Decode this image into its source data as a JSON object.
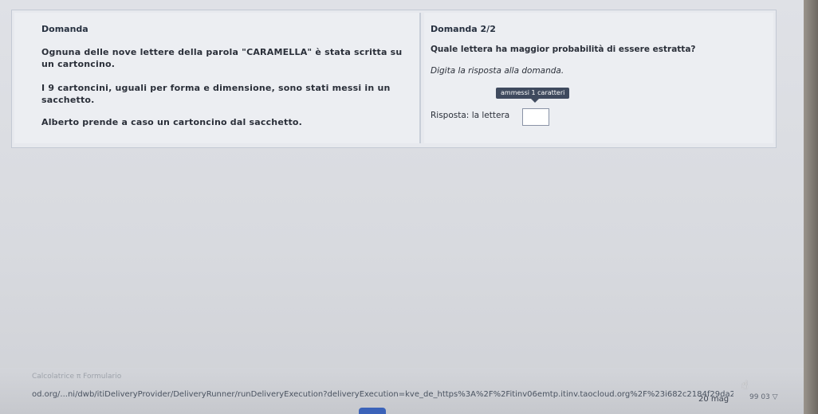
{
  "left": {
    "title": "Domanda",
    "p1a": "Ognuna delle nove lettere della parola \"CARAMELLA\" è stata scritta su",
    "p1b": "un cartoncino.",
    "p2a": "I 9 cartoncini, uguali per forma e dimensione, sono stati messi in un",
    "p2b": "sacchetto.",
    "p3": "Alberto prende a caso un cartoncino dal sacchetto."
  },
  "right": {
    "title": "Domanda 2/2",
    "question": "Quale lettera ha maggior probabilità di essere estratta?",
    "instruction": "Digita la risposta alla domanda.",
    "tooltip": "ammessi 1 caratteri",
    "answer_label": "Risposta:",
    "answer_prefix": "la lettera",
    "answer_value": ""
  },
  "browser": {
    "url": "od.org/...ni/dwb/itiDeliveryProvider/DeliveryRunner/runDeliveryExecution?deliveryExecution=kve_de_https%3A%2F%2Fitinv06emtp.itinv.taocloud.org%2F%23i682c2184f29da20",
    "toolbar_ghost": "Calcolatrice   π Formulario",
    "date": "20 mag",
    "tray": "99  03  ▽"
  }
}
